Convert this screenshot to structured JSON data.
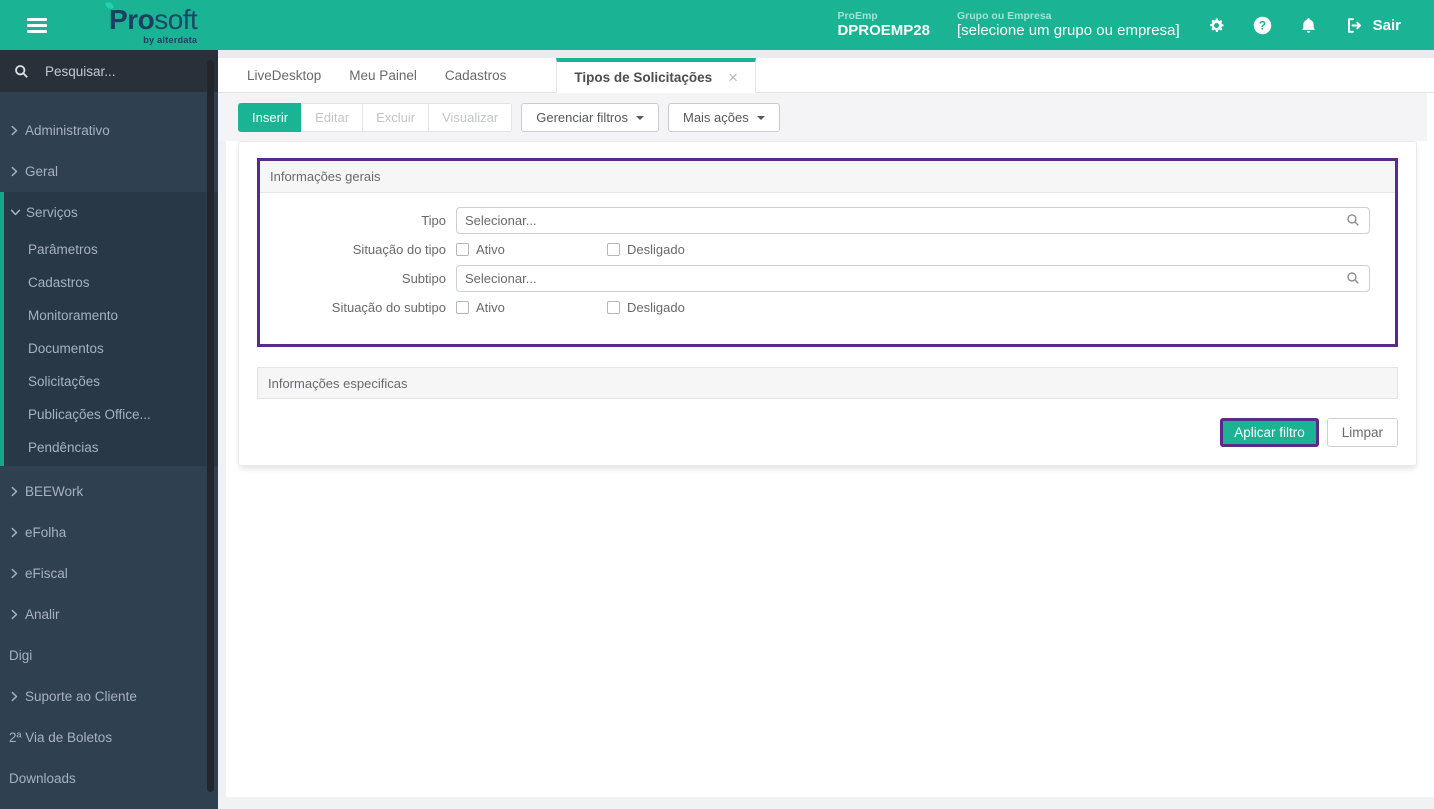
{
  "colors": {
    "primary_teal": "#1ab394",
    "sidebar_bg": "#2f4050",
    "sidebar_active_section_bg": "#293846",
    "sidebar_active_border": "#18a689",
    "highlight_purple": "#5b2a87",
    "muted_text": "#676a6c"
  },
  "icons": {
    "menu": "hamburger",
    "gear": "settings",
    "help": "question-circle",
    "bell": "notifications",
    "logout": "sign-out",
    "search": "magnifier",
    "chevron_right": "angle-right",
    "chevron_down": "angle-down",
    "close": "×",
    "caret_down": "dropdown-caret"
  },
  "topbar": {
    "brand_pro": "Pro",
    "brand_soft": "soft",
    "brand_sub": "by alterdata",
    "proemp_label": "ProEmp",
    "proemp_value": "DPROEMP28",
    "group_label": "Grupo ou Empresa",
    "group_value": "[selecione um grupo ou empresa]",
    "sair_label": "Sair"
  },
  "sidebar": {
    "search_placeholder": "Pesquisar...",
    "items": [
      {
        "label": "Administrativo",
        "chevron": "right"
      },
      {
        "label": "Geral",
        "chevron": "right"
      },
      {
        "label": "Serviços",
        "chevron": "down",
        "expanded": true,
        "children": [
          "Parâmetros",
          "Cadastros",
          "Monitoramento",
          "Documentos",
          "Solicitações",
          "Publicações Office...",
          "Pendências"
        ]
      },
      {
        "label": "BEEWork",
        "chevron": "right"
      },
      {
        "label": "eFolha",
        "chevron": "right"
      },
      {
        "label": "eFiscal",
        "chevron": "right"
      },
      {
        "label": "Analir",
        "chevron": "right"
      },
      {
        "label": "Digi",
        "chevron": null
      },
      {
        "label": "Suporte ao Cliente",
        "chevron": "right"
      },
      {
        "label": "2ª Via de Boletos",
        "chevron": null
      },
      {
        "label": "Downloads",
        "chevron": null
      }
    ]
  },
  "tabs": [
    {
      "label": "LiveDesktop",
      "active": false
    },
    {
      "label": "Meu Painel",
      "active": false
    },
    {
      "label": "Cadastros",
      "active": false
    },
    {
      "label": "Tipos de Solicitações",
      "active": true,
      "closable": true
    }
  ],
  "toolbar": {
    "inserir": "Inserir",
    "editar": "Editar",
    "excluir": "Excluir",
    "visualizar": "Visualizar",
    "gerenciar_filtros": "Gerenciar filtros",
    "mais_acoes": "Mais ações"
  },
  "filter_panel": {
    "title": "Informações gerais",
    "rows": [
      {
        "type": "select",
        "label": "Tipo",
        "placeholder": "Selecionar..."
      },
      {
        "type": "checkboxes",
        "label": "Situação do tipo",
        "options": [
          {
            "label": "Ativo",
            "checked": false
          },
          {
            "label": "Desligado",
            "checked": false
          }
        ]
      },
      {
        "type": "select",
        "label": "Subtipo",
        "placeholder": "Selecionar..."
      },
      {
        "type": "checkboxes",
        "label": "Situação do subtipo",
        "options": [
          {
            "label": "Ativo",
            "checked": false
          },
          {
            "label": "Desligado",
            "checked": false
          }
        ]
      }
    ]
  },
  "specific_panel": {
    "title": "Informações especificas"
  },
  "actions": {
    "apply": "Aplicar filtro",
    "clear": "Limpar"
  }
}
